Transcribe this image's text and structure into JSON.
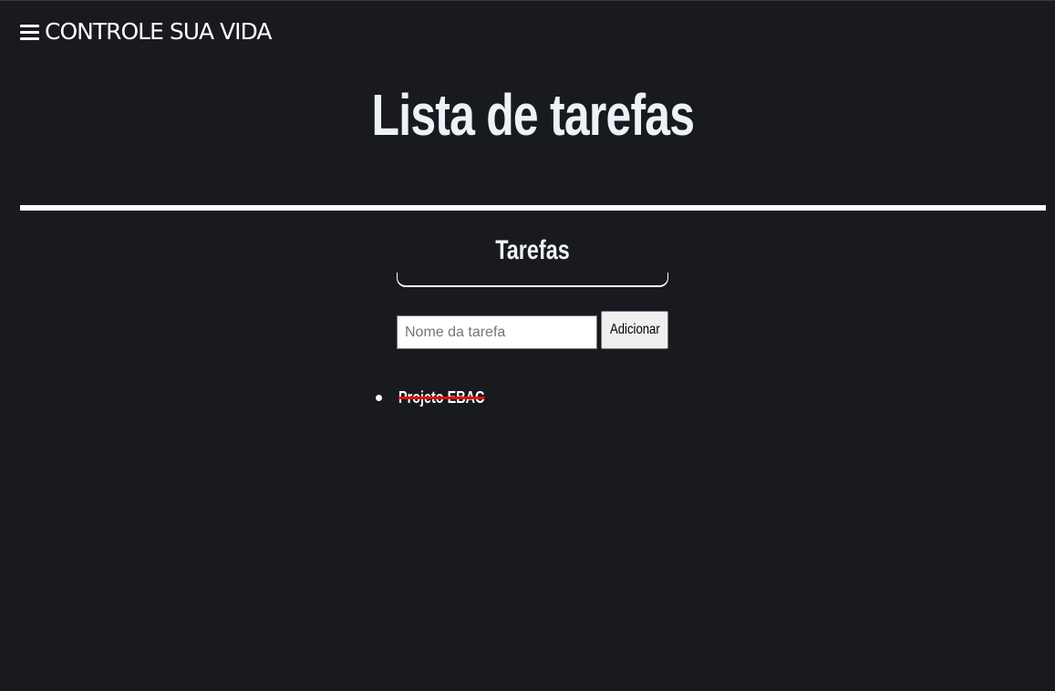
{
  "header": {
    "brand": "CONTROLE SUA VIDA",
    "menu_icon": "hamburger-menu-icon"
  },
  "main": {
    "title": "Lista de tarefas",
    "section_title": "Tarefas",
    "input": {
      "placeholder": "Nome da tarefa",
      "value": ""
    },
    "add_button_label": "Adicionar",
    "tasks": [
      {
        "label": "Projeto EBAC",
        "completed": true
      }
    ]
  },
  "colors": {
    "background": "#191a1f",
    "text": "#ffffff",
    "strike": "#e01010"
  }
}
